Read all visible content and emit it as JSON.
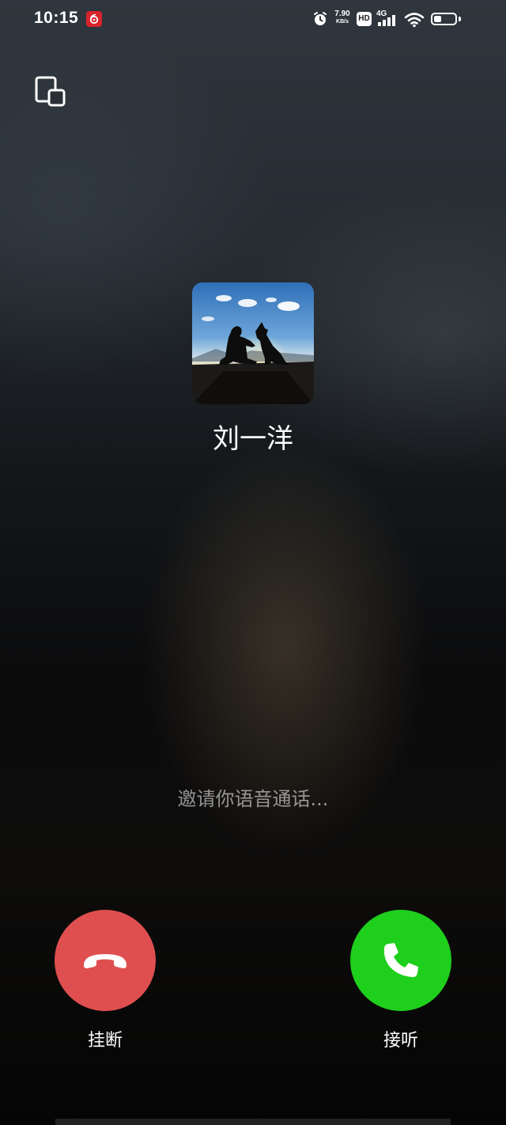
{
  "status_bar": {
    "time": "10:15",
    "net_speed_value": "7.90",
    "net_speed_unit": "KB/s",
    "hd_label": "HD",
    "network_type": "4G",
    "battery_level": 0.35,
    "icons": [
      "netease-music-icon",
      "alarm-icon",
      "hd-icon",
      "signal-icon",
      "wifi-icon",
      "battery-icon"
    ]
  },
  "call": {
    "caller_name": "刘一洋",
    "status_text": "邀请你语音通话..."
  },
  "actions": {
    "hangup_label": "挂断",
    "answer_label": "接听"
  },
  "colors": {
    "hangup": "#df4f4f",
    "answer": "#1ecf1c"
  }
}
